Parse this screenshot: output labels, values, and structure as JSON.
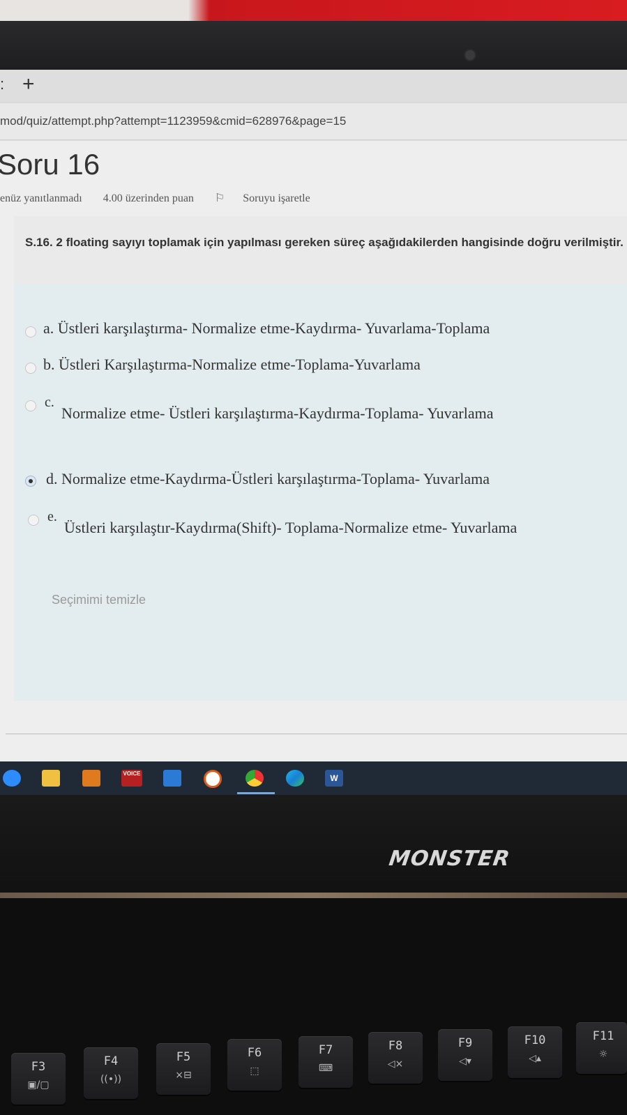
{
  "browser": {
    "new_tab": "+",
    "url": "mod/quiz/attempt.php?attempt=1123959&cmid=628976&page=15"
  },
  "question": {
    "title": "Soru 16",
    "status": "enüz yanıtlanmadı",
    "points": "4.00 üzerinden puan",
    "flag_label": "Soruyu işaretle",
    "text": "S.16. 2 floating sayıyı toplamak için yapılması gereken süreç aşağıdakilerden hangisinde doğru verilmiştir.",
    "options": [
      {
        "letter": "a.",
        "text": "Üstleri karşılaştırma- Normalize etme-Kaydırma- Yuvarlama-Toplama",
        "checked": false
      },
      {
        "letter": "b.",
        "text": "Üstleri Karşılaştırma-Normalize etme-Toplama-Yuvarlama",
        "checked": false
      },
      {
        "letter": "c.",
        "text": "Normalize etme- Üstleri karşılaştırma-Kaydırma-Toplama- Yuvarlama",
        "checked": false
      },
      {
        "letter": "d.",
        "text": "Normalize etme-Kaydırma-Üstleri karşılaştırma-Toplama- Yuvarlama",
        "checked": true
      },
      {
        "letter": "e.",
        "text": "Üstleri karşılaştır-Kaydırma(Shift)- Toplama-Normalize etme- Yuvarlama",
        "checked": false
      }
    ],
    "clear_label": "Seçimimi temizle"
  },
  "taskbar": {
    "icons": [
      "zoom-icon",
      "file-explorer-icon",
      "app-icon",
      "voicemeeter-icon",
      "mail-icon",
      "media-player-icon",
      "chrome-icon",
      "edge-icon",
      "word-icon"
    ],
    "voicemeeter_label": "VOICE",
    "word_label": "W"
  },
  "laptop": {
    "brand": "MONSTER",
    "fkeys": [
      {
        "label": "F3",
        "sub": "▣/▢"
      },
      {
        "label": "F4",
        "sub": "((•))"
      },
      {
        "label": "F5",
        "sub": "×⊟"
      },
      {
        "label": "F6",
        "sub": "⬚"
      },
      {
        "label": "F7",
        "sub": "⌨"
      },
      {
        "label": "F8",
        "sub": "◁×"
      },
      {
        "label": "F9",
        "sub": "◁▾"
      },
      {
        "label": "F10",
        "sub": "◁▴"
      },
      {
        "label": "F11",
        "sub": "☼"
      }
    ]
  },
  "colors": {
    "taskbar": "#1f2a36",
    "question_box": "#e3ecef",
    "accent_red": "#d81c20"
  }
}
